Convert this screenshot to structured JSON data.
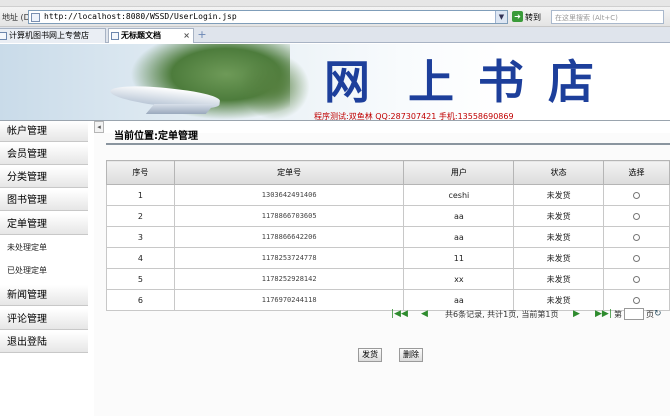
{
  "browser": {
    "address_label": "地址 (D)",
    "url": "http://localhost:8080/WSSD/UserLogin.jsp",
    "go_label": "转到",
    "search_placeholder": "在这里搜索 (Alt+C)",
    "tabs": [
      {
        "label": "计算机图书网上专营店",
        "active": false
      },
      {
        "label": "无标题文档",
        "active": true
      }
    ]
  },
  "banner": {
    "title_chars": [
      "网",
      "上",
      "书",
      "店"
    ],
    "info": "程序测试:双鱼林  QQ:287307421  手机:13558690869"
  },
  "sidebar": {
    "items": [
      {
        "label": "帐户管理",
        "type": "menu"
      },
      {
        "label": "会员管理",
        "type": "menu"
      },
      {
        "label": "分类管理",
        "type": "menu"
      },
      {
        "label": "图书管理",
        "type": "menu"
      },
      {
        "label": "定单管理",
        "type": "menu"
      },
      {
        "label": "未处理定单",
        "type": "sub"
      },
      {
        "label": "已处理定单",
        "type": "sub"
      },
      {
        "label": "新闻管理",
        "type": "menu"
      },
      {
        "label": "评论管理",
        "type": "menu"
      },
      {
        "label": "退出登陆",
        "type": "menu"
      }
    ]
  },
  "main": {
    "location": "当前位置:定单管理",
    "table": {
      "headers": [
        "序号",
        "定单号",
        "用户",
        "状态",
        "选择"
      ],
      "rows": [
        [
          "1",
          "1303642491406",
          "ceshi",
          "未发货"
        ],
        [
          "2",
          "1178866703605",
          "aa",
          "未发货"
        ],
        [
          "3",
          "1178866642206",
          "aa",
          "未发货"
        ],
        [
          "4",
          "1178253724778",
          "11",
          "未发货"
        ],
        [
          "5",
          "1178252928142",
          "xx",
          "未发货"
        ],
        [
          "6",
          "1176970244118",
          "aa",
          "未发货"
        ]
      ]
    },
    "pager": {
      "summary": "共6条记录, 共计1页, 当前第1页",
      "goto_prefix": "第",
      "goto_suffix": "页"
    },
    "buttons": {
      "ship": "发货",
      "delete": "删除"
    }
  },
  "colors": {
    "banner_title": "#1d3f9b",
    "banner_info": "#c00000",
    "pager_icons": "#2e8b2e"
  }
}
